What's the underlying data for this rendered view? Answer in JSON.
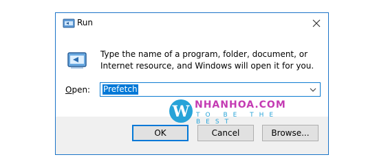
{
  "window": {
    "title": "Run"
  },
  "icons": {
    "title": "run-app-icon",
    "close": "close-icon",
    "main": "run-app-icon",
    "dropdown": "chevron-down-icon"
  },
  "description": "Type the name of a program, folder, document, or Internet resource, and Windows will open it for you.",
  "open_field": {
    "label_prefix": "O",
    "label_rest": "pen:",
    "value": "Prefetch"
  },
  "buttons": {
    "ok": "OK",
    "cancel": "Cancel",
    "browse": "Browse..."
  },
  "watermark": {
    "brand": "NHANHOA.COM",
    "tagline": "TO BE THE BEST"
  },
  "colors": {
    "accent": "#0078d7",
    "footer": "#f0f0f0",
    "brand": "#c43bb3",
    "tagline": "#27a3d8"
  }
}
